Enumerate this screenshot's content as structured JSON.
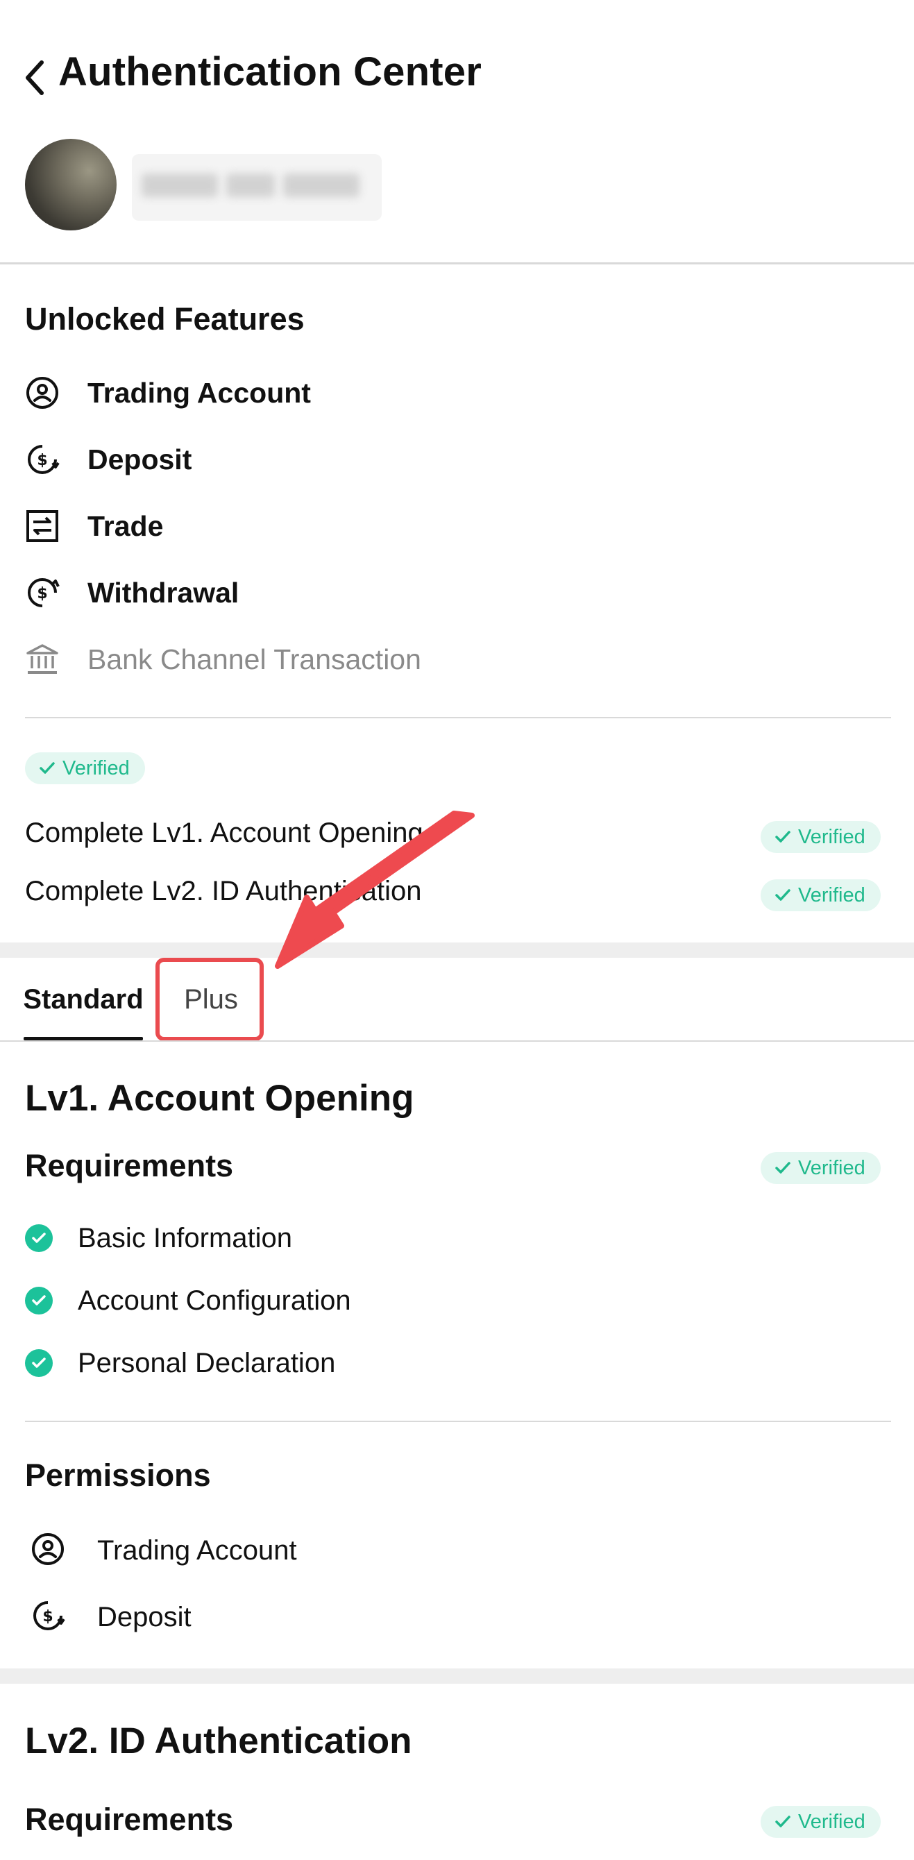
{
  "header": {
    "title": "Authentication Center",
    "back_icon": "chevron-left-icon"
  },
  "unlocked": {
    "title": "Unlocked Features",
    "items": [
      {
        "label": "Trading Account",
        "icon": "user-circle-icon",
        "enabled": true
      },
      {
        "label": "Deposit",
        "icon": "dollar-in-icon",
        "enabled": true
      },
      {
        "label": "Trade",
        "icon": "swap-icon",
        "enabled": true
      },
      {
        "label": "Withdrawal",
        "icon": "dollar-out-icon",
        "enabled": true
      },
      {
        "label": "Bank Channel Transaction",
        "icon": "bank-icon",
        "enabled": false
      }
    ]
  },
  "verification": {
    "status_badge": "Verified",
    "steps": [
      {
        "label": "Complete Lv1. Account Opening",
        "status": "Verified"
      },
      {
        "label": "Complete Lv2. ID Authentication",
        "status": "Verified"
      }
    ]
  },
  "tabs": [
    {
      "label": "Standard",
      "active": true
    },
    {
      "label": "Plus",
      "active": false,
      "highlighted": true
    }
  ],
  "lv1": {
    "title": "Lv1. Account Opening",
    "requirements_title": "Requirements",
    "requirements_status": "Verified",
    "requirements": [
      "Basic Information",
      "Account Configuration",
      "Personal Declaration"
    ],
    "permissions_title": "Permissions",
    "permissions": [
      {
        "label": "Trading Account",
        "icon": "user-circle-icon"
      },
      {
        "label": "Deposit",
        "icon": "dollar-in-icon"
      }
    ]
  },
  "lv2": {
    "title": "Lv2. ID Authentication",
    "requirements_title": "Requirements",
    "requirements_status": "Verified"
  },
  "colors": {
    "accent_green": "#1cc29a",
    "badge_bg": "#e4f7f1",
    "highlight_red": "#ea4b4f"
  }
}
